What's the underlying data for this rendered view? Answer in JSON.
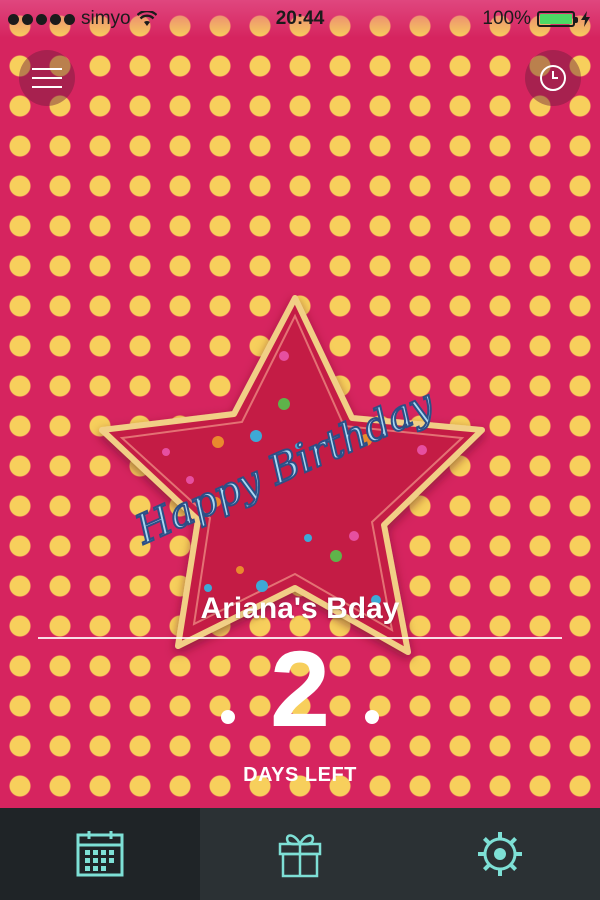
{
  "status_bar": {
    "carrier": "simyo",
    "time": "20:44",
    "battery": "100%",
    "battery_level": 1.0
  },
  "icons": {
    "menu": "hamburger-menu-icon",
    "history": "clock-icon",
    "signal": "signal-dots-icon",
    "wifi": "wifi-icon",
    "battery": "battery-icon",
    "charging": "charging-bolt-icon",
    "tab_calendar": "calendar-icon",
    "tab_gift": "gift-icon",
    "tab_settings": "gear-icon"
  },
  "artwork": {
    "text": "Happy Birthday"
  },
  "event": {
    "name": "Ariana's Bday",
    "count": "2",
    "count_label": "DAYS LEFT"
  },
  "colors": {
    "background": "#d6245f",
    "polka_dot": "#f7cf5c",
    "tab_bar": "#2b3134",
    "tab_icon": "#7ee0d6",
    "star": "#c41f45"
  }
}
